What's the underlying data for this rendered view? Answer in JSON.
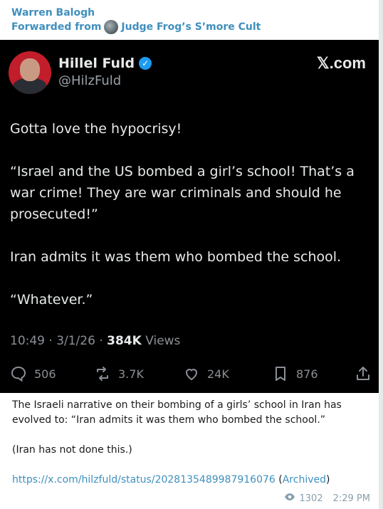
{
  "message": {
    "sender": "Warren Balogh",
    "forwarded_prefix": "Forwarded from",
    "forwarded_channel": "Judge Frog’s S’more Cult",
    "caption_line1": "The Israeli narrative on their bombing of a girls’ school in Iran has evolved to: “Iran admits it was them who bombed the school.”",
    "caption_line2": "(Iran has not done this.)",
    "link_text": "https://x.com/hilzfuld/status/2028135489987916076",
    "archived_open": " (",
    "archived_text": "Archived",
    "archived_close": ")",
    "views": "1302",
    "time": "2:29 PM"
  },
  "tweet": {
    "name": "Hillel Fuld",
    "handle": "@HilzFuld",
    "brand": "𝕏.com",
    "paragraphs": [
      "Gotta love the hypocrisy!",
      "“Israel and the US bombed a girl’s school! That’s a war crime! They are war criminals and should he prosecuted!”",
      "Iran admits it was them who bombed the school.",
      "“Whatever.”"
    ],
    "timestamp": "10:49 · 3/1/26 · ",
    "views_count": "384K",
    "views_label": " Views",
    "replies": "506",
    "reposts": "3.7K",
    "likes": "24K",
    "bookmarks": "876"
  },
  "colors": {
    "accent": "#3f8fbd",
    "tweet_bg": "#000000",
    "verified": "#1d9bf0"
  },
  "icons": [
    "reply-icon",
    "repost-icon",
    "like-icon",
    "bookmark-icon",
    "share-icon",
    "verified-icon",
    "eye-icon"
  ]
}
